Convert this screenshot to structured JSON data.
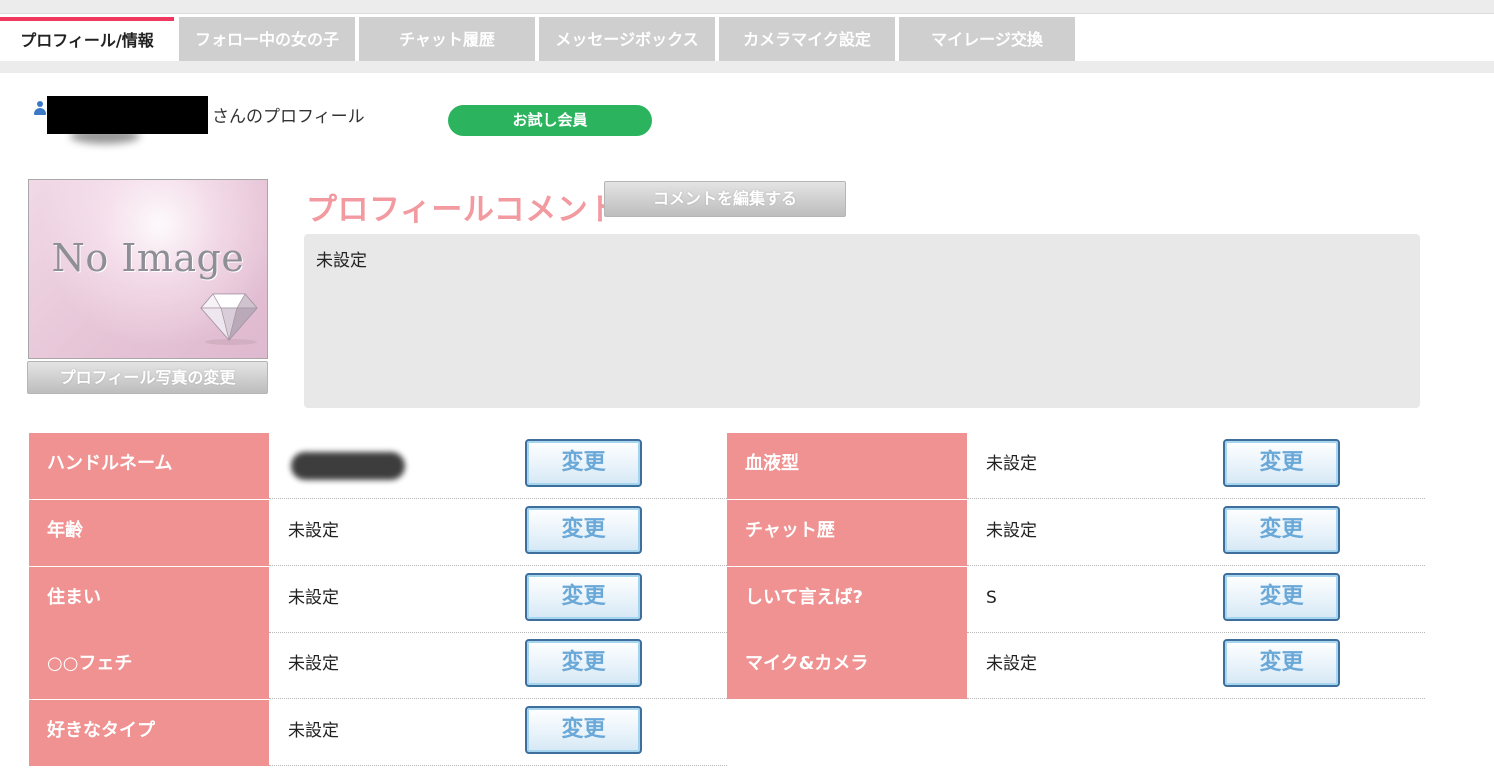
{
  "tabs": [
    {
      "label": "プロフィール/情報",
      "active": true
    },
    {
      "label": "フォロー中の女の子",
      "active": false
    },
    {
      "label": "チャット履歴",
      "active": false
    },
    {
      "label": "メッセージボックス",
      "active": false
    },
    {
      "label": "カメラマイク設定",
      "active": false
    },
    {
      "label": "マイレージ交換",
      "active": false
    }
  ],
  "header": {
    "name_suffix": "さんのプロフィール",
    "membership_badge": "お試し会員"
  },
  "photo": {
    "placeholder_text": "No Image",
    "change_button": "プロフィール写真の変更"
  },
  "comment": {
    "title": "プロフィールコメント",
    "edit_button": "コメントを編集する",
    "text": "未設定"
  },
  "profile_fields": {
    "left": [
      {
        "label": "ハンドルネーム",
        "value": "",
        "button": "変更"
      },
      {
        "label": "年齢",
        "value": "未設定",
        "button": "変更"
      },
      {
        "label": "住まい",
        "value": "未設定",
        "button": "変更"
      },
      {
        "label": "○○フェチ",
        "value": "未設定",
        "button": "変更"
      },
      {
        "label": "好きなタイプ",
        "value": "未設定",
        "button": "変更"
      }
    ],
    "right": [
      {
        "label": "血液型",
        "value": "未設定",
        "button": "変更"
      },
      {
        "label": "チャット歴",
        "value": "未設定",
        "button": "変更"
      },
      {
        "label": "しいて言えば?",
        "value": "S",
        "button": "変更"
      },
      {
        "label": "マイク&カメラ",
        "value": "未設定",
        "button": "変更"
      }
    ]
  },
  "colors": {
    "active_tab_accent": "#f0385f",
    "label_bg": "#ef9291",
    "badge_bg": "#2bb35e",
    "comment_title": "#f29aa0"
  }
}
